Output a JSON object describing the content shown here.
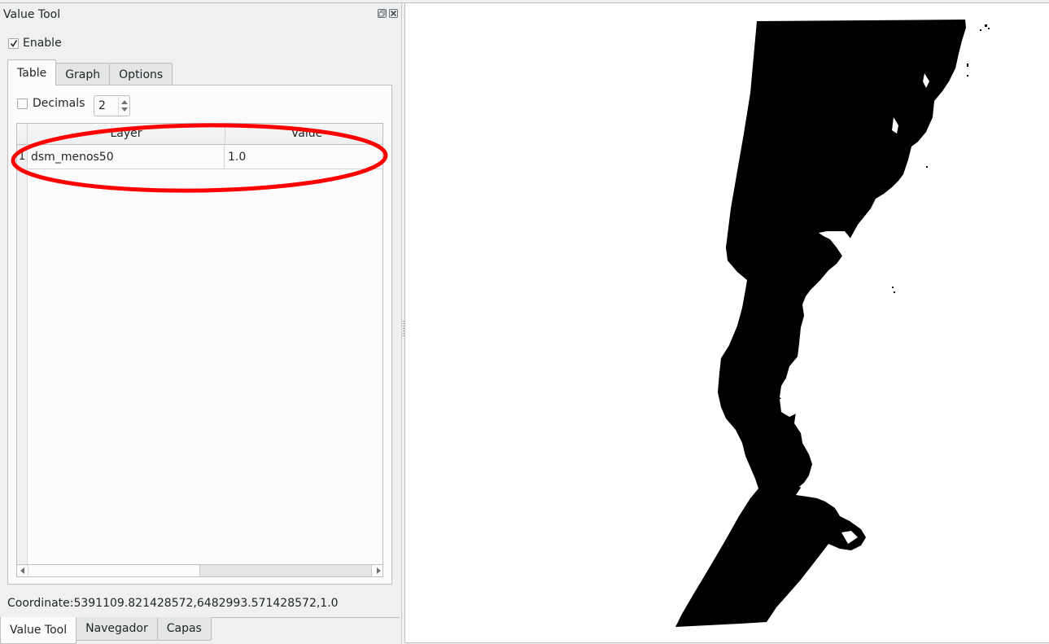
{
  "dock": {
    "title": "Value Tool",
    "float_button": "float-icon",
    "close_button": "close-icon",
    "enable": {
      "label": "Enable",
      "checked": true
    },
    "tabs": [
      {
        "label": "Table",
        "active": true
      },
      {
        "label": "Graph",
        "active": false
      },
      {
        "label": "Options",
        "active": false
      }
    ],
    "decimals": {
      "label": "Decimals",
      "checked": false,
      "value": "2"
    },
    "table": {
      "columns": [
        "Layer",
        "Value"
      ],
      "rows": [
        {
          "num": "1",
          "layer": "dsm_menos50",
          "value": "1.0"
        }
      ]
    },
    "coordinate_text": "Coordinate:5391109.821428572,6482993.571428572,1.0",
    "annotation_color": "#ff0000"
  },
  "bottom_tabs": [
    {
      "label": "Value Tool",
      "active": true
    },
    {
      "label": "Navegador",
      "active": false
    },
    {
      "label": "Capas",
      "active": false
    }
  ],
  "map": {
    "layer_fill": "#000000",
    "background": "#ffffff"
  }
}
